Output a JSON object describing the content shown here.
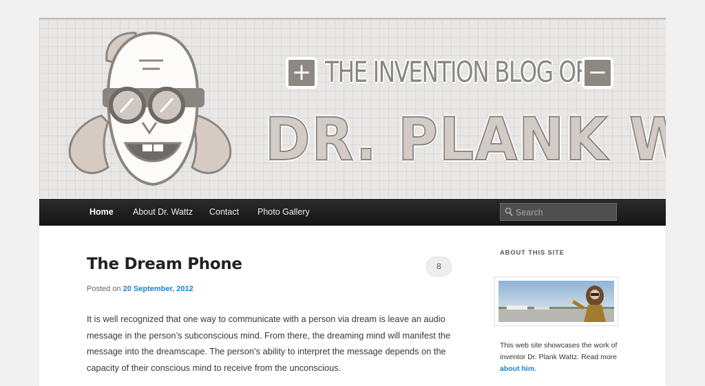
{
  "banner": {
    "logo_line1": "THE INVENTION BLOG OF",
    "logo_line2": "DR. PLANK WATTZ",
    "plus_symbol": "+",
    "minus_symbol": "−",
    "logo_colors": {
      "fill": "#d2cbc6",
      "stroke": "#8b8580",
      "background": "#e8e7e5"
    }
  },
  "nav": {
    "items": [
      {
        "label": "Home",
        "active": true
      },
      {
        "label": "About Dr. Wattz",
        "active": false
      },
      {
        "label": "Contact",
        "active": false
      },
      {
        "label": "Photo Gallery",
        "active": false
      }
    ],
    "search": {
      "placeholder": "Search",
      "icon": "search-icon"
    }
  },
  "post": {
    "title": "The Dream Phone",
    "posted_on_label": "Posted on",
    "date": "20 September, 2012",
    "comment_count": "8",
    "body": "It is well recognized that one way to communicate with a person via dream is leave an audio message in the person’s subconscious mind. From there, the dreaming mind will manifest the message into the dreamscape. The person’s ability to interpret the message depends on the capacity of their conscious mind to receive from the unconscious."
  },
  "sidebar": {
    "widget_title": "ABOUT THIS SITE",
    "about_text_pre": "This web site showcases the work of inventor Dr. Plank Wattz.  Read more",
    "about_link": "about him",
    "about_text_post": "."
  },
  "colors": {
    "link": "#1982d1",
    "nav_bg": "#1f1f1f",
    "page_bg": "#f1f1f1"
  }
}
